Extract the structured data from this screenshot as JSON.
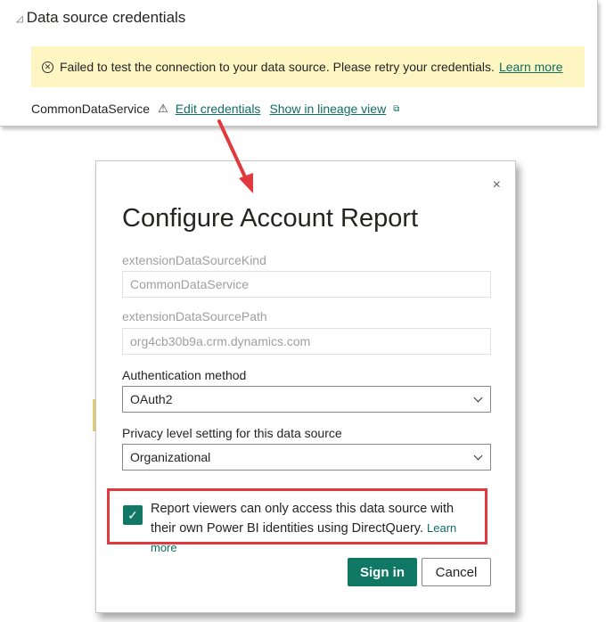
{
  "section": {
    "title": "Data source credentials",
    "collapse_icon": "triangle-icon"
  },
  "warning": {
    "message": "Failed to test the connection to your data source. Please retry your credentials.",
    "learn_more": "Learn more"
  },
  "credential_row": {
    "source_name": "CommonDataService",
    "edit_link": "Edit credentials",
    "lineage_link": "Show in lineage view"
  },
  "dialog": {
    "title": "Configure Account Report",
    "close_glyph": "×",
    "fields": {
      "kind_label": "extensionDataSourceKind",
      "kind_value": "CommonDataService",
      "path_label": "extensionDataSourcePath",
      "path_value": "org4cb30b9a.crm.dynamics.com",
      "auth_label": "Authentication method",
      "auth_value": "OAuth2",
      "privacy_label": "Privacy level setting for this data source",
      "privacy_value": "Organizational"
    },
    "checkbox": {
      "checked": true,
      "text": "Report viewers can only access this data source with their own Power BI identities using DirectQuery.",
      "learn_more": "Learn more"
    },
    "sign_in": "Sign in",
    "cancel": "Cancel"
  },
  "colors": {
    "accent": "#117865",
    "link": "#0f6d61",
    "warning_bg": "#fdf6c3",
    "highlight": "#e03a3e"
  }
}
